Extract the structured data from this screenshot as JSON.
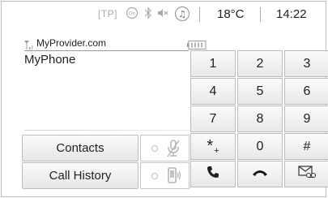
{
  "status_bar": {
    "tp": "[TP]",
    "temperature": "18°C",
    "time": "14:22",
    "icons": [
      "tp-indicator",
      "onstar-icon",
      "bluetooth-icon",
      "mute-icon",
      "music-icon"
    ]
  },
  "phone": {
    "provider": "MyProvider.com",
    "device_name": "MyPhone",
    "signal_icon": "signal-strength-icon",
    "battery_icon": "battery-icon"
  },
  "buttons": {
    "contacts": "Contacts",
    "call_history": "Call History"
  },
  "toggles": {
    "mute_icon": "microphone-mute-icon",
    "handsfree_icon": "phone-speaker-icon"
  },
  "keypad": {
    "keys": [
      "1",
      "2",
      "3",
      "4",
      "5",
      "6",
      "7",
      "8",
      "9",
      "*",
      "0",
      "#"
    ],
    "star_plus": "+",
    "action_icons": [
      "call-icon",
      "hang-up-icon",
      "voicemail-icon"
    ]
  },
  "colors": {
    "call_icon": "#222222",
    "button_border": "#bcbcbc",
    "status_grey": "#a9a9a9"
  }
}
